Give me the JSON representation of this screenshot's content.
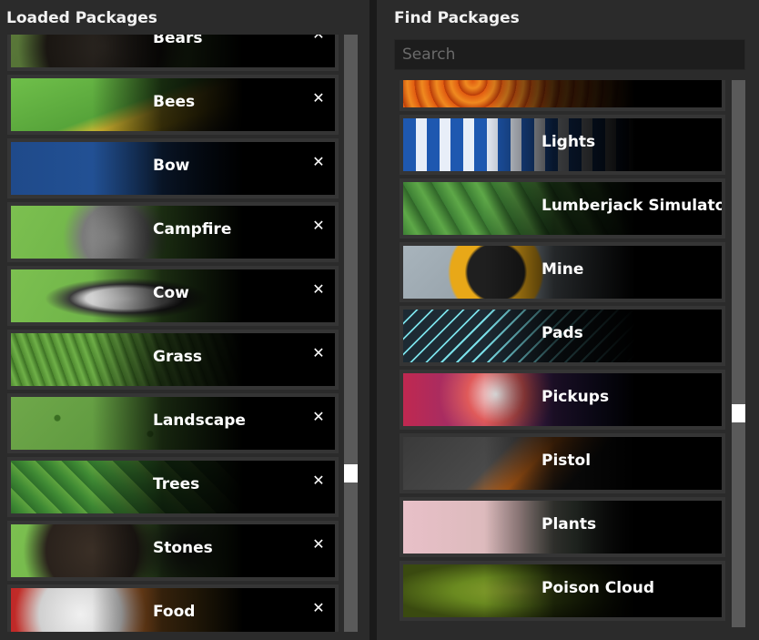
{
  "loaded_panel": {
    "title": "Loaded Packages",
    "items": [
      {
        "label": "Bears",
        "thumb": "t-bears"
      },
      {
        "label": "Bees",
        "thumb": "t-bees"
      },
      {
        "label": "Bow",
        "thumb": "t-bow"
      },
      {
        "label": "Campfire",
        "thumb": "t-campfire"
      },
      {
        "label": "Cow",
        "thumb": "t-cow"
      },
      {
        "label": "Grass",
        "thumb": "t-grass"
      },
      {
        "label": "Landscape",
        "thumb": "t-landscape"
      },
      {
        "label": "Trees",
        "thumb": "t-trees"
      },
      {
        "label": "Stones",
        "thumb": "t-stones"
      },
      {
        "label": "Food",
        "thumb": "t-food"
      }
    ],
    "remove_glyph": "✕"
  },
  "find_panel": {
    "title": "Find Packages",
    "search_placeholder": "Search",
    "items": [
      {
        "label": "",
        "thumb": "t-lava"
      },
      {
        "label": "Lights",
        "thumb": "t-lights"
      },
      {
        "label": "Lumberjack Simulato",
        "thumb": "t-lumber"
      },
      {
        "label": "Mine",
        "thumb": "t-mine"
      },
      {
        "label": "Pads",
        "thumb": "t-pads"
      },
      {
        "label": "Pickups",
        "thumb": "t-pickups"
      },
      {
        "label": "Pistol",
        "thumb": "t-pistol"
      },
      {
        "label": "Plants",
        "thumb": "t-plants"
      },
      {
        "label": "Poison Cloud",
        "thumb": "t-poison"
      }
    ]
  },
  "colors": {
    "panel_bg": "#2b2b2b",
    "item_frame": "#353535",
    "scroll_track": "#5a5a5a",
    "scroll_thumb": "#ffffff"
  }
}
